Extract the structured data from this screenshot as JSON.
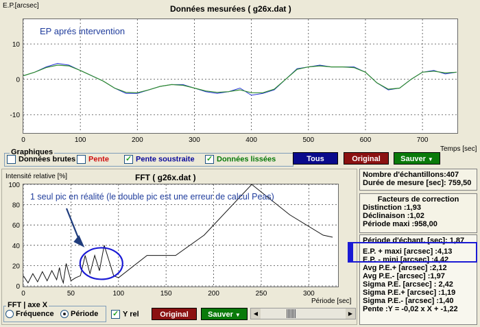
{
  "top_chart": {
    "title": "Données mesurées ( g26x.dat )",
    "ylabel": "E.P.[arcsec]",
    "xlabel": "Temps [sec]",
    "annotation": "EP aprés intervention",
    "y_ticks": [
      "10",
      "0",
      "-10"
    ],
    "x_ticks": [
      "0",
      "100",
      "200",
      "300",
      "400",
      "500",
      "600",
      "700"
    ]
  },
  "graphiques": {
    "group_label": "Graphiques",
    "brutes_label": "Données brutes",
    "pente_label": "Pente",
    "pente_soustraite_label": "Pente soustraite",
    "lissees_label": "Données lissées",
    "brutes_checked": false,
    "pente_checked": false,
    "pente_soustraite_checked": true,
    "lissees_checked": true
  },
  "buttons": {
    "tous": "Tous",
    "original_top": "Original",
    "sauver_top": "Sauver",
    "original_bottom": "Original",
    "sauver_bottom": "Sauver"
  },
  "fft_chart": {
    "title": "FFT ( g26x.dat )",
    "ylabel": "Intensité relative [%]",
    "xlabel": "Période [sec]",
    "annotation": "1 seul pic en réalité (le double pic est une erreur de calcul Peas)",
    "y_ticks": [
      "100",
      "80",
      "60",
      "40",
      "20",
      "0"
    ],
    "x_ticks": [
      "0",
      "50",
      "100",
      "150",
      "200",
      "250",
      "300"
    ]
  },
  "fft_axis": {
    "group_label": "FFT | axe X",
    "frequence_label": "Fréquence",
    "periode_label": "Période",
    "frequence_selected": false,
    "periode_selected": true,
    "yrel_label": "Y rel",
    "yrel_checked": true
  },
  "info": {
    "echantillons": "Nombre d'échantillons:407",
    "duree": "Durée de mesure [sec]: 759,50"
  },
  "facteurs": {
    "title_line1": "Facteurs de correction",
    "distinction": "Distinction :1,93",
    "declinaison": "Déclinaison :1,02",
    "periode_maxi": "Période maxi :958,00"
  },
  "stats": {
    "periode_echant": "Période d'échant. [sec]: 1,87",
    "ep_plus_maxi": "E.P. + maxi [arcsec] :4,13",
    "ep_minus_mini": "E.P. - mini [arcsec] :4,42",
    "avg_pe_plus": "Avg P.E.+ [arcsec] :2,12",
    "avg_pe_minus": "Avg P.E.- [arcsec] :1,97",
    "sigma_pe": "Sigma P.E. [arcsec] : 2,42",
    "sigma_pe_plus": "Sigma P.E.+ [arcsec] :1,19",
    "sigma_pe_minus": "Sigma P.E.- [arcsec] :1,40",
    "pente": "Pente :Y = -0,02 x X + -1,22"
  },
  "colors": {
    "raw_series": "#1f2fd6",
    "smooth_series": "#2e8b2e",
    "annotation_text": "#1f3c9c",
    "highlight": "#1a1ad4"
  },
  "chart_data": [
    {
      "type": "line",
      "title": "Données mesurées ( g26x.dat )",
      "xlabel": "Temps [sec]",
      "ylabel": "E.P.[arcsec]",
      "xlim": [
        0,
        760
      ],
      "ylim": [
        -15,
        17
      ],
      "series": [
        {
          "x": [
            0,
            20,
            40,
            60,
            80,
            100,
            120,
            140,
            160,
            180,
            200,
            220,
            240,
            260,
            280,
            300,
            320,
            340,
            360,
            380,
            400,
            420,
            440,
            460,
            480,
            500,
            520,
            540,
            560,
            580,
            600,
            620,
            640,
            660,
            680,
            700,
            720,
            740,
            760
          ],
          "y": [
            1,
            2,
            3.5,
            4.5,
            4,
            2.5,
            1,
            -0.5,
            -2.5,
            -4,
            -4,
            -3,
            -2,
            -1.5,
            -1.5,
            -2.5,
            -3.5,
            -4,
            -3.5,
            -2.5,
            -4.5,
            -4,
            -3,
            0,
            3,
            3.5,
            4,
            3.5,
            3.5,
            3.5,
            2,
            -1,
            -3,
            -2.5,
            0,
            2,
            2.5,
            1.5,
            2
          ]
        },
        {
          "x": [
            0,
            20,
            40,
            60,
            80,
            100,
            120,
            140,
            160,
            180,
            200,
            220,
            240,
            260,
            280,
            300,
            320,
            340,
            360,
            380,
            400,
            420,
            440,
            460,
            480,
            500,
            520,
            540,
            560,
            580,
            600,
            620,
            640,
            660,
            680,
            700,
            720,
            740,
            760
          ],
          "y": [
            1,
            2,
            3.3,
            4,
            3.8,
            2.5,
            1,
            -0.5,
            -2.5,
            -3.7,
            -3.8,
            -3,
            -2,
            -1.5,
            -1.7,
            -2.5,
            -3.3,
            -3.7,
            -3.5,
            -3,
            -3.8,
            -3.8,
            -2.8,
            0,
            2.8,
            3.5,
            3.8,
            3.5,
            3.5,
            3.3,
            2,
            -1,
            -2.8,
            -2.5,
            0,
            2,
            2.3,
            1.8,
            2
          ]
        }
      ]
    },
    {
      "type": "line",
      "title": "FFT ( g26x.dat )",
      "xlabel": "Période [sec]",
      "ylabel": "Intensité relative [%]",
      "xlim": [
        0,
        330
      ],
      "ylim": [
        0,
        100
      ],
      "series": [
        {
          "x": [
            0,
            5,
            10,
            15,
            20,
            25,
            30,
            35,
            38,
            40,
            42,
            45,
            48,
            50,
            55,
            60,
            65,
            70,
            75,
            80,
            85,
            90,
            95,
            100,
            130,
            160,
            190,
            240,
            280,
            315,
            325
          ],
          "y": [
            10,
            3,
            12,
            4,
            14,
            5,
            15,
            6,
            18,
            8,
            3,
            22,
            12,
            5,
            8,
            10,
            30,
            12,
            30,
            15,
            40,
            25,
            10,
            8,
            30,
            30,
            50,
            100,
            70,
            50,
            48
          ]
        }
      ]
    }
  ]
}
